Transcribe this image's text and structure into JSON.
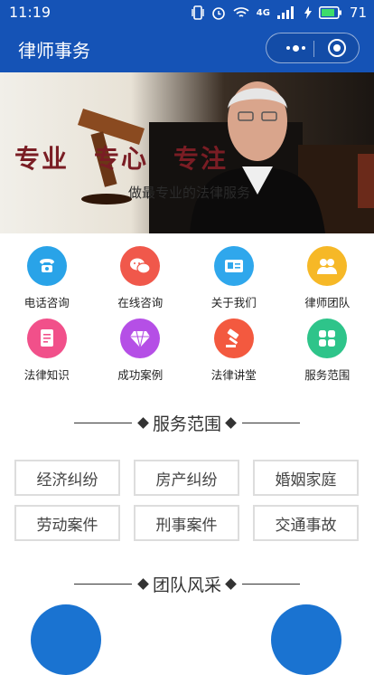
{
  "status": {
    "time": "11:19",
    "network": "4G",
    "battery": "71"
  },
  "nav": {
    "title": "律师事务"
  },
  "banner": {
    "words": [
      "专业",
      "专心",
      "专注"
    ],
    "subtitle": "做最专业的法律服务"
  },
  "grid": [
    {
      "label": "电话咨询",
      "icon": "phone-icon",
      "color": "#29a3e8"
    },
    {
      "label": "在线咨询",
      "icon": "chat-icon",
      "color": "#f0584b"
    },
    {
      "label": "关于我们",
      "icon": "id-card-icon",
      "color": "#2fa7ec"
    },
    {
      "label": "律师团队",
      "icon": "team-icon",
      "color": "#f6b827"
    },
    {
      "label": "法律知识",
      "icon": "document-icon",
      "color": "#f1508a"
    },
    {
      "label": "成功案例",
      "icon": "diamond-icon",
      "color": "#b54fe6"
    },
    {
      "label": "法律讲堂",
      "icon": "gavel-icon",
      "color": "#f3593f"
    },
    {
      "label": "服务范围",
      "icon": "grid-icon",
      "color": "#2ec48a"
    }
  ],
  "sections": {
    "services": "服务范围",
    "team": "团队风采"
  },
  "tags": [
    "经济纠纷",
    "房产纠纷",
    "婚姻家庭",
    "劳动案件",
    "刑事案件",
    "交通事故"
  ]
}
